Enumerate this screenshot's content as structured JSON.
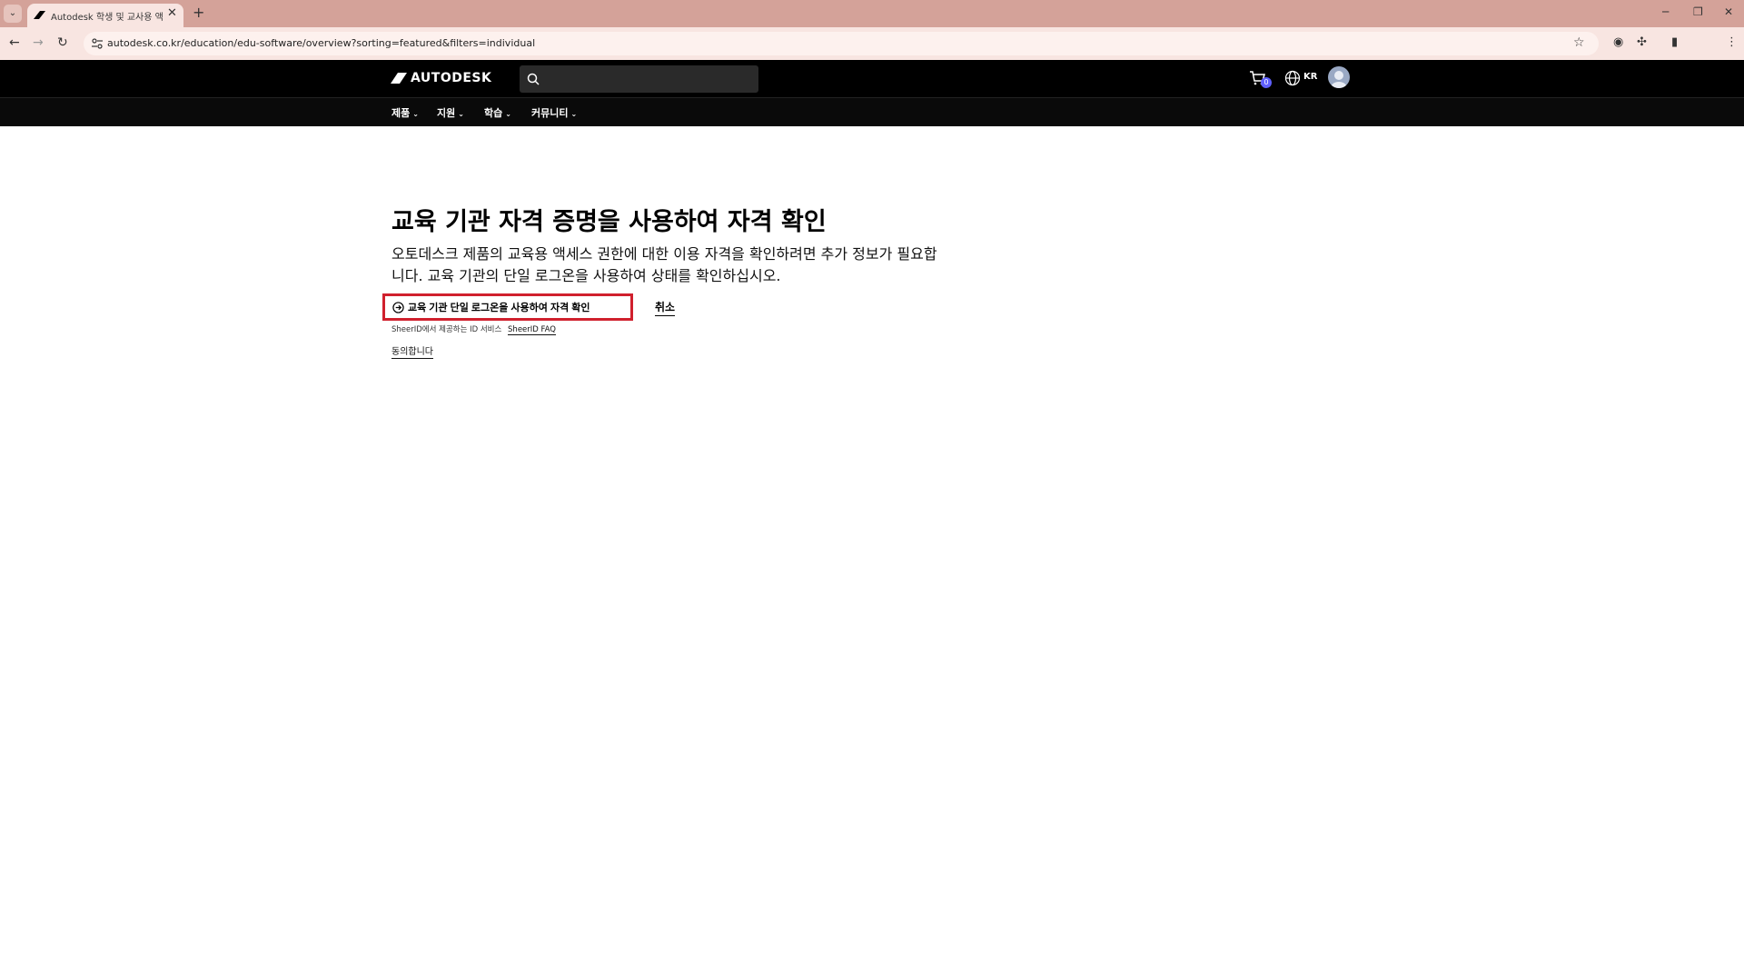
{
  "browser": {
    "tab_title": "Autodesk 학생 및 교사용 액세",
    "url": "autodesk.co.kr/education/edu-software/overview?sorting=featured&filters=individual"
  },
  "header": {
    "logo_text": "AUTODESK",
    "search_placeholder": "",
    "cart_count": "0",
    "locale": "KR"
  },
  "nav": {
    "items": [
      "제품",
      "지원",
      "학습",
      "커뮤니티"
    ]
  },
  "main": {
    "heading": "교육 기관 자격 증명을 사용하여 자격 확인",
    "description": "오토데스크 제품의 교육용 액세스 권한에 대한 이용 자격을 확인하려면 추가 정보가 필요합니다. 교육 기관의 단일 로그온을 사용하여 상태를 확인하십시오.",
    "sso_button_label": "교육 기관 단일 로그온을 사용하여 자격 확인",
    "cancel_label": "취소",
    "sheerid_note": "SheerID에서 제공하는 ID 서비스",
    "sheerid_faq": "SheerID FAQ",
    "agree_label": "동의합니다"
  },
  "colors": {
    "chrome_tabstrip": "#d4a299",
    "chrome_toolbar": "#f8e5e1",
    "site_header": "#000000",
    "highlight": "#d0202d",
    "cart_badge": "#5f60ff"
  }
}
